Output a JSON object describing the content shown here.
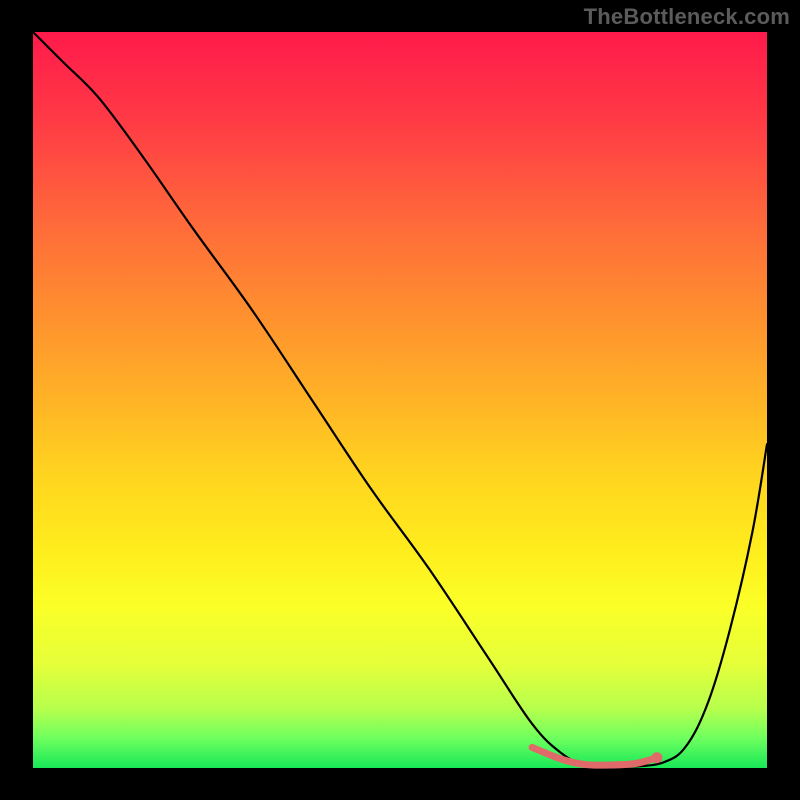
{
  "attribution": "TheBottleneck.com",
  "colors": {
    "highlight": "#e06a6a",
    "curve": "#000000",
    "gradient_top": "#ff1a4b",
    "gradient_bottom": "#18e858",
    "frame": "#000000"
  },
  "chart_data": {
    "type": "line",
    "title": "",
    "xlabel": "",
    "ylabel": "",
    "xlim": [
      0,
      100
    ],
    "ylim": [
      0,
      100
    ],
    "note": "Axis values are estimated as percent of plot area; no tick labels are shown in the image.",
    "series": [
      {
        "name": "bottleneck-curve",
        "x": [
          0,
          4,
          9,
          15,
          22,
          30,
          38,
          46,
          54,
          62,
          68,
          72,
          75,
          78,
          82,
          86,
          89,
          92,
          95,
          98,
          100
        ],
        "y": [
          100,
          96,
          91,
          83,
          73,
          62,
          50,
          38,
          27,
          15,
          6,
          2,
          0.5,
          0.2,
          0.2,
          0.8,
          3,
          9,
          19,
          32,
          44
        ]
      }
    ],
    "highlight_region": {
      "name": "optimal-range",
      "x": [
        68,
        72,
        75,
        78,
        82,
        85
      ],
      "y": [
        2.8,
        1.2,
        0.5,
        0.4,
        0.6,
        1.4
      ]
    }
  }
}
